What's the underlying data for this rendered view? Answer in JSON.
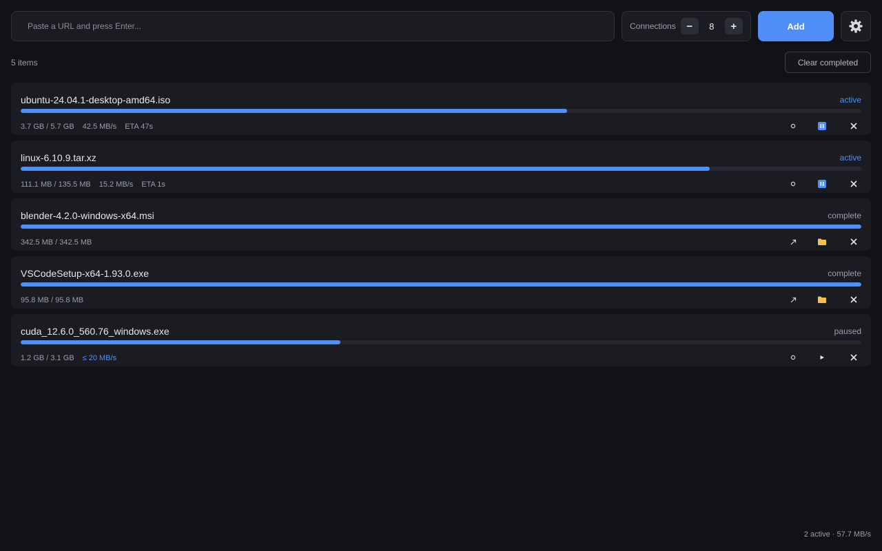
{
  "toolbar": {
    "url_placeholder": "Paste a URL and press Enter...",
    "connections_label": "Connections",
    "connections_value": "8",
    "decrement": "−",
    "increment": "+",
    "add_label": "Add"
  },
  "list_header": {
    "count": "5 items",
    "clear_label": "Clear completed"
  },
  "colors": {
    "accent": "#4f8ff7",
    "folder": "#f2c14e",
    "background": "#111216",
    "card": "#1a1c22"
  },
  "downloads": [
    {
      "name": "ubuntu-24.04.1-desktop-amd64.iso",
      "status": "active",
      "progress_percent": 65,
      "size": "3.7 GB / 5.7 GB",
      "speed": "42.5 MB/s",
      "eta": "ETA 47s",
      "actions": [
        "limit-icon",
        "pause-icon",
        "close-icon"
      ]
    },
    {
      "name": "linux-6.10.9.tar.xz",
      "status": "active",
      "progress_percent": 82,
      "size": "111.1 MB / 135.5 MB",
      "speed": "15.2 MB/s",
      "eta": "ETA 1s",
      "actions": [
        "limit-icon",
        "pause-icon",
        "close-icon"
      ]
    },
    {
      "name": "blender-4.2.0-windows-x64.msi",
      "status": "complete",
      "progress_percent": 100,
      "size": "342.5 MB / 342.5 MB",
      "actions": [
        "open-icon",
        "folder-icon",
        "close-icon"
      ]
    },
    {
      "name": "VSCodeSetup-x64-1.93.0.exe",
      "status": "complete",
      "progress_percent": 100,
      "size": "95.8 MB / 95.8 MB",
      "actions": [
        "open-icon",
        "folder-icon",
        "close-icon"
      ]
    },
    {
      "name": "cuda_12.6.0_560.76_windows.exe",
      "status": "paused",
      "progress_percent": 38,
      "size": "1.2 GB / 3.1 GB",
      "limit": "≤ 20 MB/s",
      "actions": [
        "limit-icon",
        "resume-icon",
        "close-icon"
      ]
    }
  ],
  "footer": {
    "summary": "2 active · 57.7 MB/s"
  }
}
